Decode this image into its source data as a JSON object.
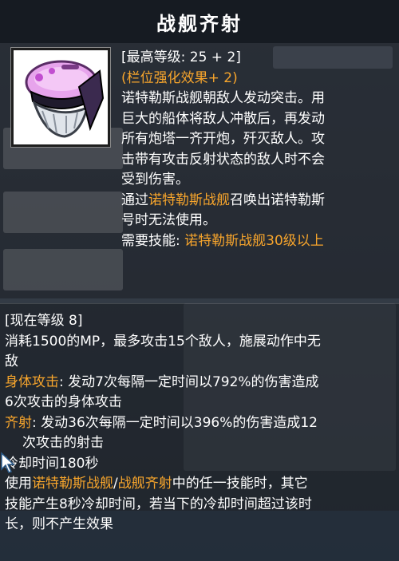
{
  "tooltip": {
    "title": "战舰齐射",
    "max_level": "[最高等级: 25 + 2]",
    "slot_bonus": "(栏位强化效果+ 2)",
    "desc": [
      "诺特勒斯战舰朝敌人发动突击。用",
      "巨大的船体将敌人冲散后，再发动",
      "所有炮塔一齐开炮，歼灭敌人。攻",
      "击带有攻击反射状态的敌人时不会",
      "受到伤害。"
    ],
    "summon_note": {
      "prefix": "通过",
      "highlight": "诺特勒斯战舰",
      "suffix": "召唤出诺特勒斯",
      "line2": "号时无法使用。"
    },
    "required_skill": {
      "label": "需要技能: ",
      "value": "诺特勒斯战舰30级以上"
    },
    "current_level": "[现在等级 8]",
    "cost_lines": [
      "消耗1500的MP，最多攻击15个敌人，施展动作中无",
      "敌"
    ],
    "body_attack": {
      "label": "身体攻击",
      "text": ": 发动7次每隔一定时间以792%的伤害造成",
      "line2": "6次攻击的身体攻击"
    },
    "volley": {
      "label": "齐射",
      "text": ": 发动36次每隔一定时间以396%的伤害造成12",
      "line2": "次攻击的射击"
    },
    "cooldown": "冷却时间180秒",
    "shared_cd": {
      "prefix": "使用",
      "skill1": "诺特勒斯战舰",
      "sep": "/",
      "skill2": "战舰齐射",
      "suffix": "中的任一技能时，其它",
      "line2": "技能产生8秒冷却时间，若当下的冷却时间超过该时",
      "line3": "长，则不产生效果"
    }
  },
  "colors": {
    "highlight": "#f7a52c",
    "text": "#ffffff"
  },
  "icons": {
    "skill_icon": "pink-battleship-skill-icon",
    "cursor": "mouse-cursor-icon"
  }
}
